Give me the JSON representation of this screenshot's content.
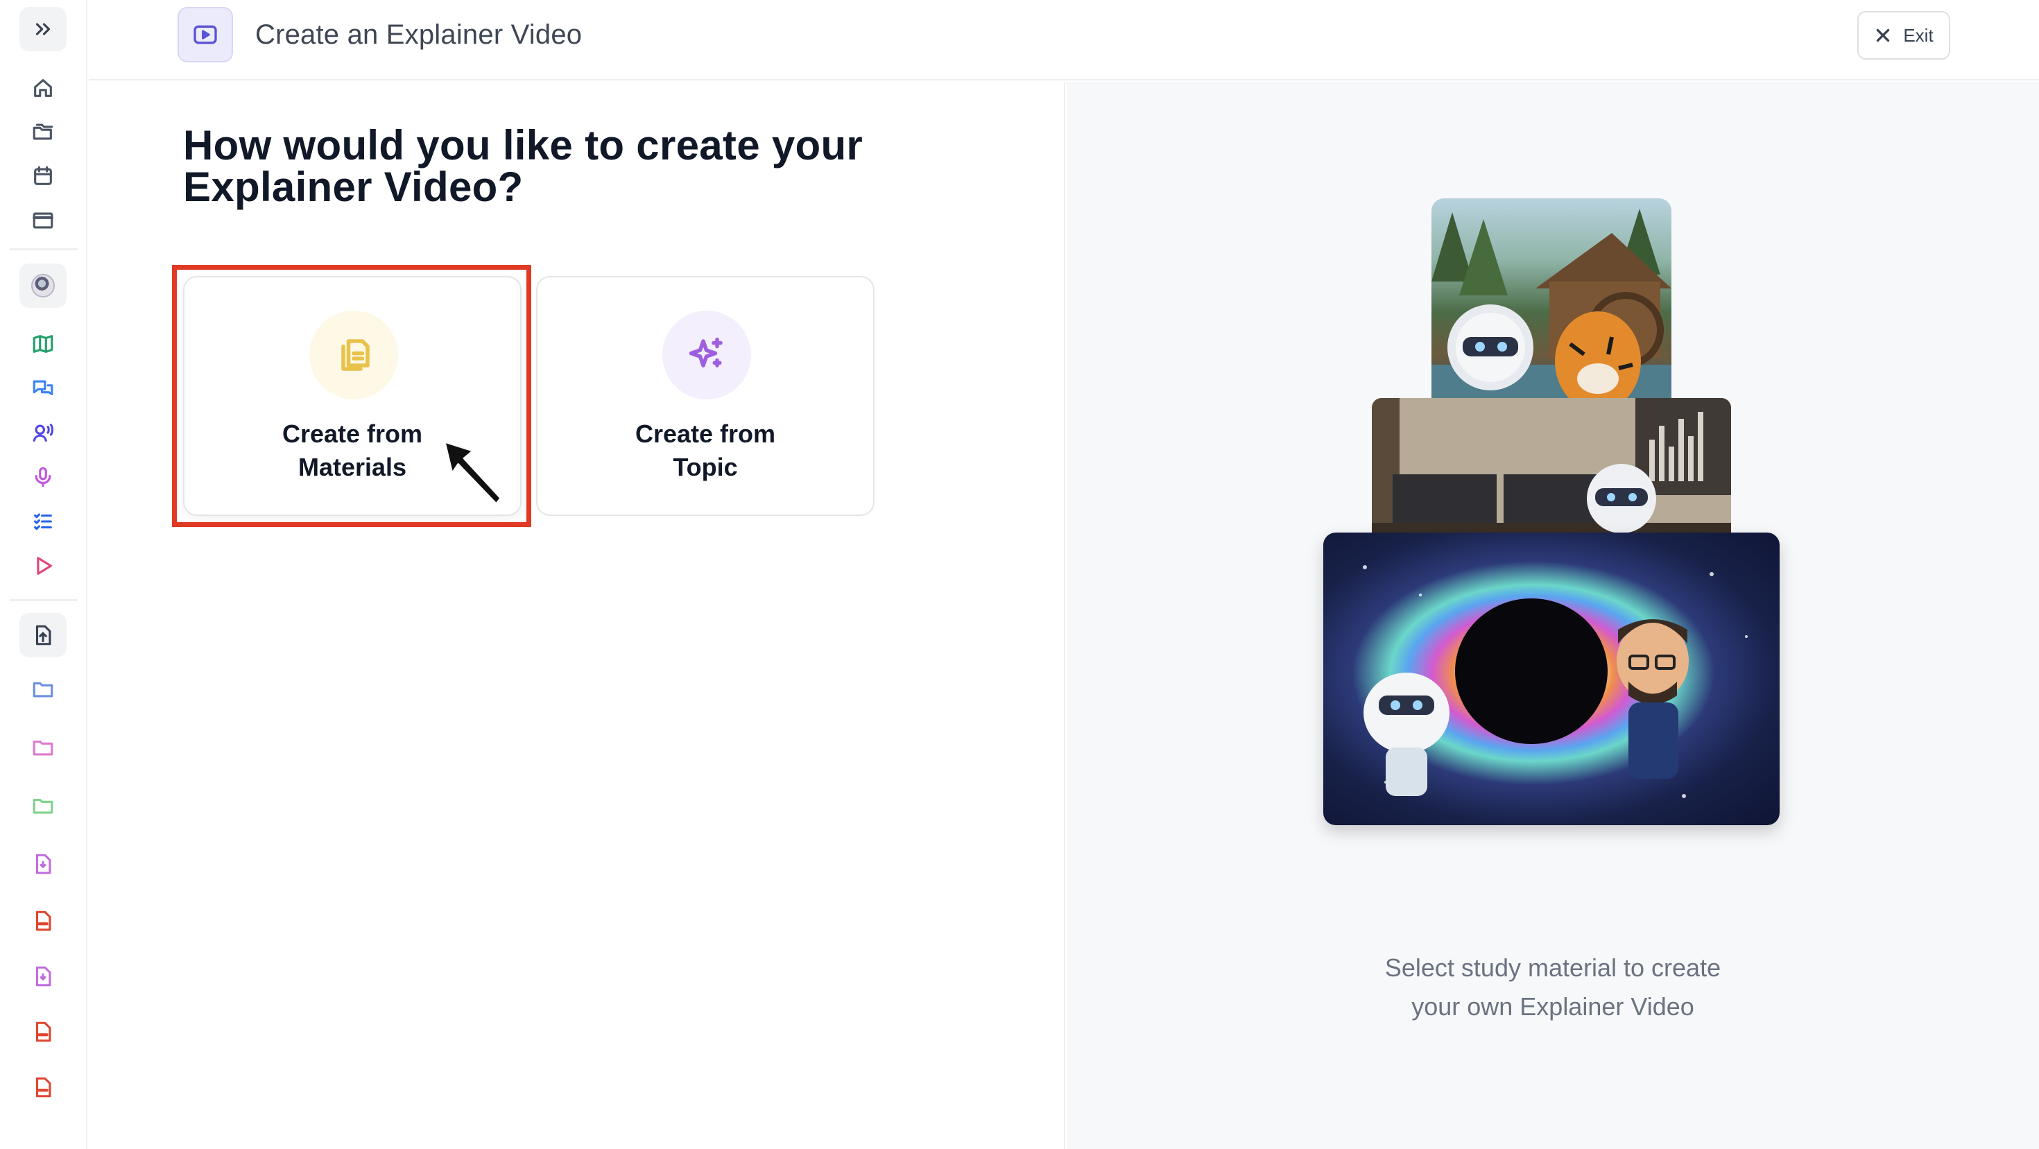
{
  "header": {
    "title": "Create an Explainer Video",
    "exit_label": "Exit"
  },
  "main": {
    "question": "How would you like to create your Explainer Video?",
    "options": [
      {
        "label_line1": "Create from",
        "label_line2": "Materials",
        "icon": "document-copy-icon",
        "selected": true
      },
      {
        "label_line1": "Create from",
        "label_line2": "Topic",
        "icon": "sparkles-icon",
        "selected": false
      }
    ]
  },
  "preview": {
    "caption_line1": "Select study material to create",
    "caption_line2": "your own Explainer Video"
  },
  "sidebar": {
    "icons": [
      "expand-chevrons-icon",
      "home-icon",
      "folders-icon",
      "calendar-icon",
      "window-icon",
      "avatar-icon",
      "map-icon",
      "chat-bubbles-icon",
      "voice-user-icon",
      "microphone-icon",
      "checklist-icon",
      "play-icon",
      "upload-file-icon",
      "folder-icon",
      "folder-icon",
      "folder-icon",
      "audio-file-icon",
      "pdf-file-icon",
      "audio-file-icon",
      "pdf-file-icon",
      "pdf-file-icon"
    ]
  },
  "colors": {
    "accent_purple": "#9d5fe0",
    "accent_yellow": "#e8c24a",
    "highlight_red": "#e13a24"
  }
}
